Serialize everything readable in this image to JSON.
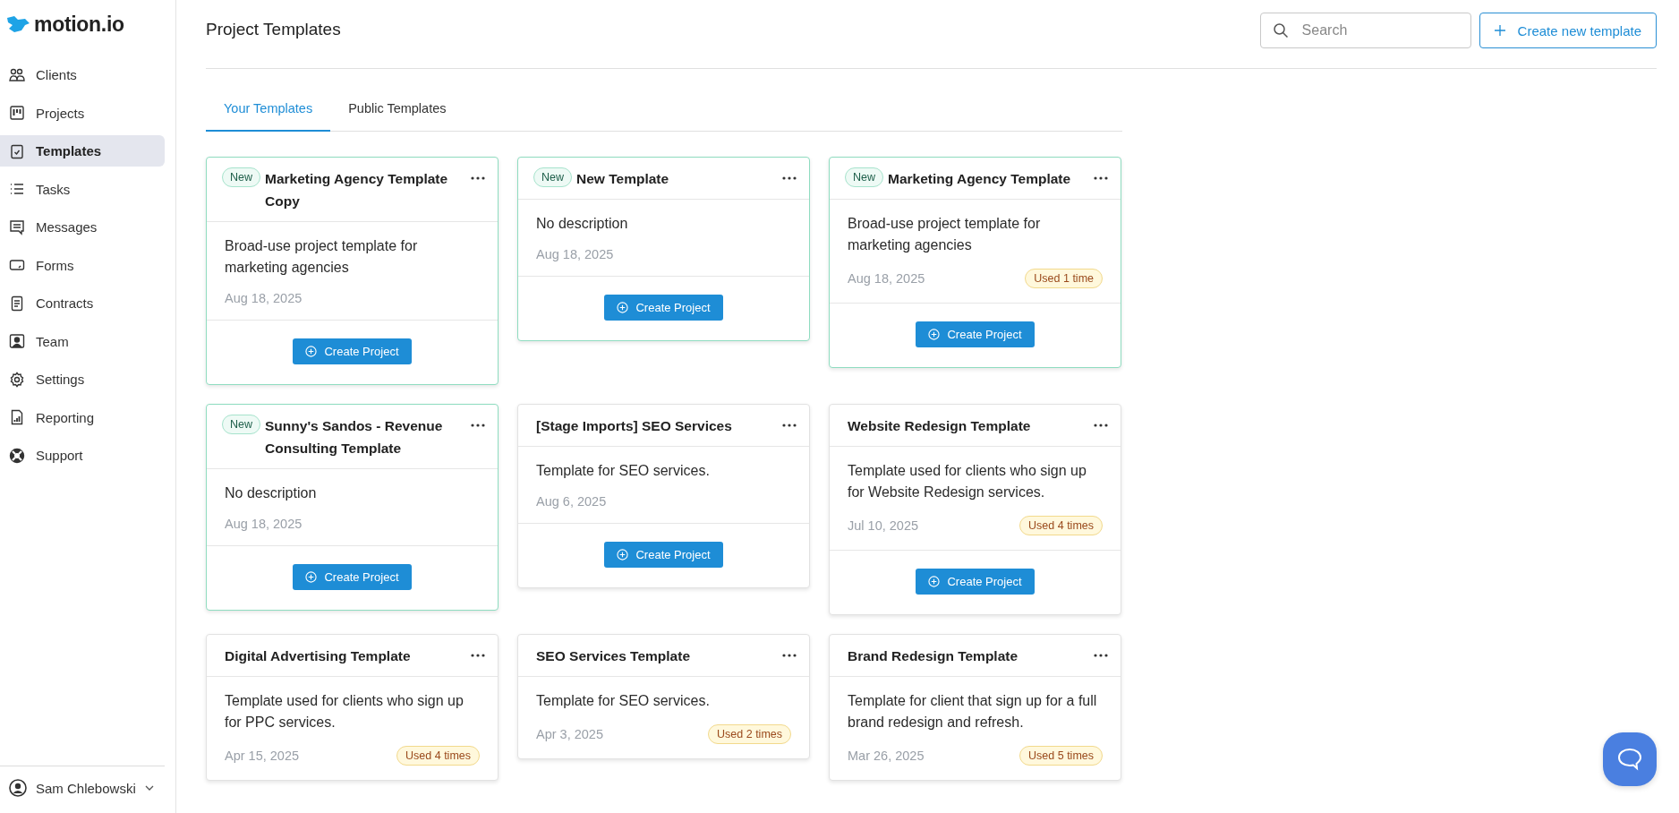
{
  "sidebar": {
    "logo": "motion.io",
    "items": [
      {
        "label": "Clients",
        "selected": false
      },
      {
        "label": "Projects",
        "selected": false
      },
      {
        "label": "Templates",
        "selected": true
      },
      {
        "label": "Tasks",
        "selected": false
      },
      {
        "label": "Messages",
        "selected": false
      },
      {
        "label": "Forms",
        "selected": false
      },
      {
        "label": "Contracts",
        "selected": false
      },
      {
        "label": "Team",
        "selected": false
      },
      {
        "label": "Settings",
        "selected": false
      },
      {
        "label": "Reporting",
        "selected": false
      },
      {
        "label": "Support",
        "selected": false
      }
    ],
    "user": {
      "name": "Sam Chlebowski"
    }
  },
  "header": {
    "title": "Project Templates",
    "search": {
      "placeholder": "Search"
    },
    "create_button": "Create new template"
  },
  "tabs": [
    {
      "label": "Your Templates",
      "selected": true
    },
    {
      "label": "Public Templates",
      "selected": false
    }
  ],
  "cards": [
    {
      "tag": "New",
      "highlighted": true,
      "title": "Marketing Agency Template Copy",
      "description": "Broad-use project template for marketing agencies",
      "date": "Aug 18, 2025",
      "button": "Create Project"
    },
    {
      "tag": "New",
      "highlighted": true,
      "title": "New Template",
      "description": "No description",
      "date": "Aug 18, 2025",
      "button": "Create Project"
    },
    {
      "tag": "New",
      "highlighted": true,
      "title": "Marketing Agency Template",
      "description": "Broad-use project template for marketing agencies",
      "date": "Aug 18, 2025",
      "usage": "Used 1 time",
      "button": "Create Project"
    },
    {
      "tag": "New",
      "highlighted": true,
      "title": "Sunny's Sandos - Revenue Consulting Template",
      "description": "No description",
      "date": "Aug 18, 2025",
      "button": "Create Project"
    },
    {
      "highlighted": false,
      "title": "[Stage Imports] SEO Services",
      "description": "Template for SEO services.",
      "date": "Aug 6, 2025",
      "button": "Create Project"
    },
    {
      "highlighted": false,
      "title": "Website Redesign Template",
      "description": "Template used for clients who sign up for Website Redesign services.",
      "date": "Jul 10, 2025",
      "usage": "Used 4 times",
      "button": "Create Project"
    },
    {
      "highlighted": false,
      "title": "Digital Advertising Template",
      "description": "Template used for clients who sign up for PPC services.",
      "date": "Apr 15, 2025",
      "usage": "Used 4 times"
    },
    {
      "highlighted": false,
      "title": "SEO Services Template",
      "description": "Template for SEO services.",
      "date": "Apr 3, 2025",
      "usage": "Used 2 times"
    },
    {
      "highlighted": false,
      "title": "Brand Redesign Template",
      "description": "Template for client that sign up for a full brand redesign and refresh.",
      "date": "Mar 26, 2025",
      "usage": "Used 5 times"
    }
  ]
}
